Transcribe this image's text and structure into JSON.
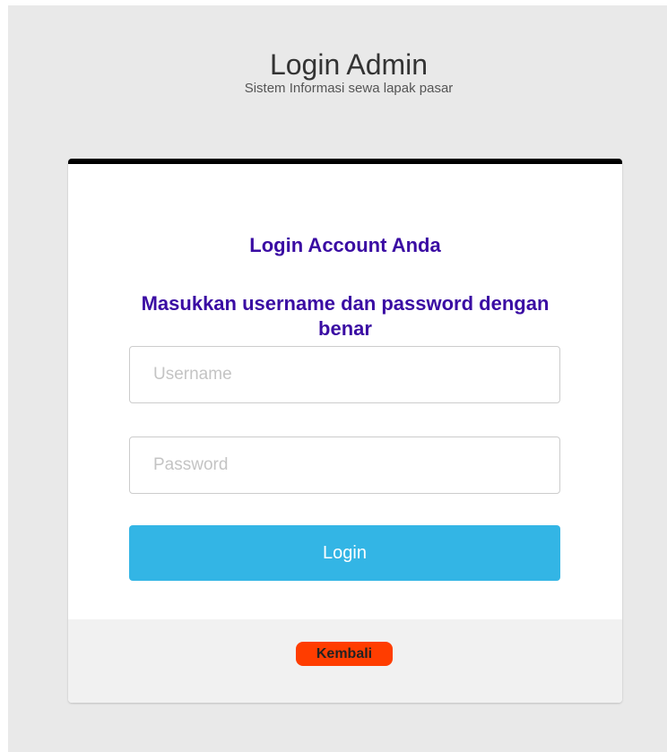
{
  "header": {
    "title": "Login Admin",
    "subtitle": "Sistem Informasi sewa lapak pasar"
  },
  "login_card": {
    "heading": "Login Account Anda",
    "instruction": "Masukkan username dan password dengan benar",
    "username": {
      "value": "",
      "placeholder": "Username"
    },
    "password": {
      "value": "",
      "placeholder": "Password"
    },
    "login_button_label": "Login",
    "footer": {
      "back_label": "Kembali"
    }
  },
  "colors": {
    "page_background": "#e9e9e9",
    "card_top_border": "#000000",
    "heading_text": "#3a0ca3",
    "login_button": "#33b5e5",
    "back_badge": "#ff3d00",
    "footer_background": "#f1f1f1"
  }
}
